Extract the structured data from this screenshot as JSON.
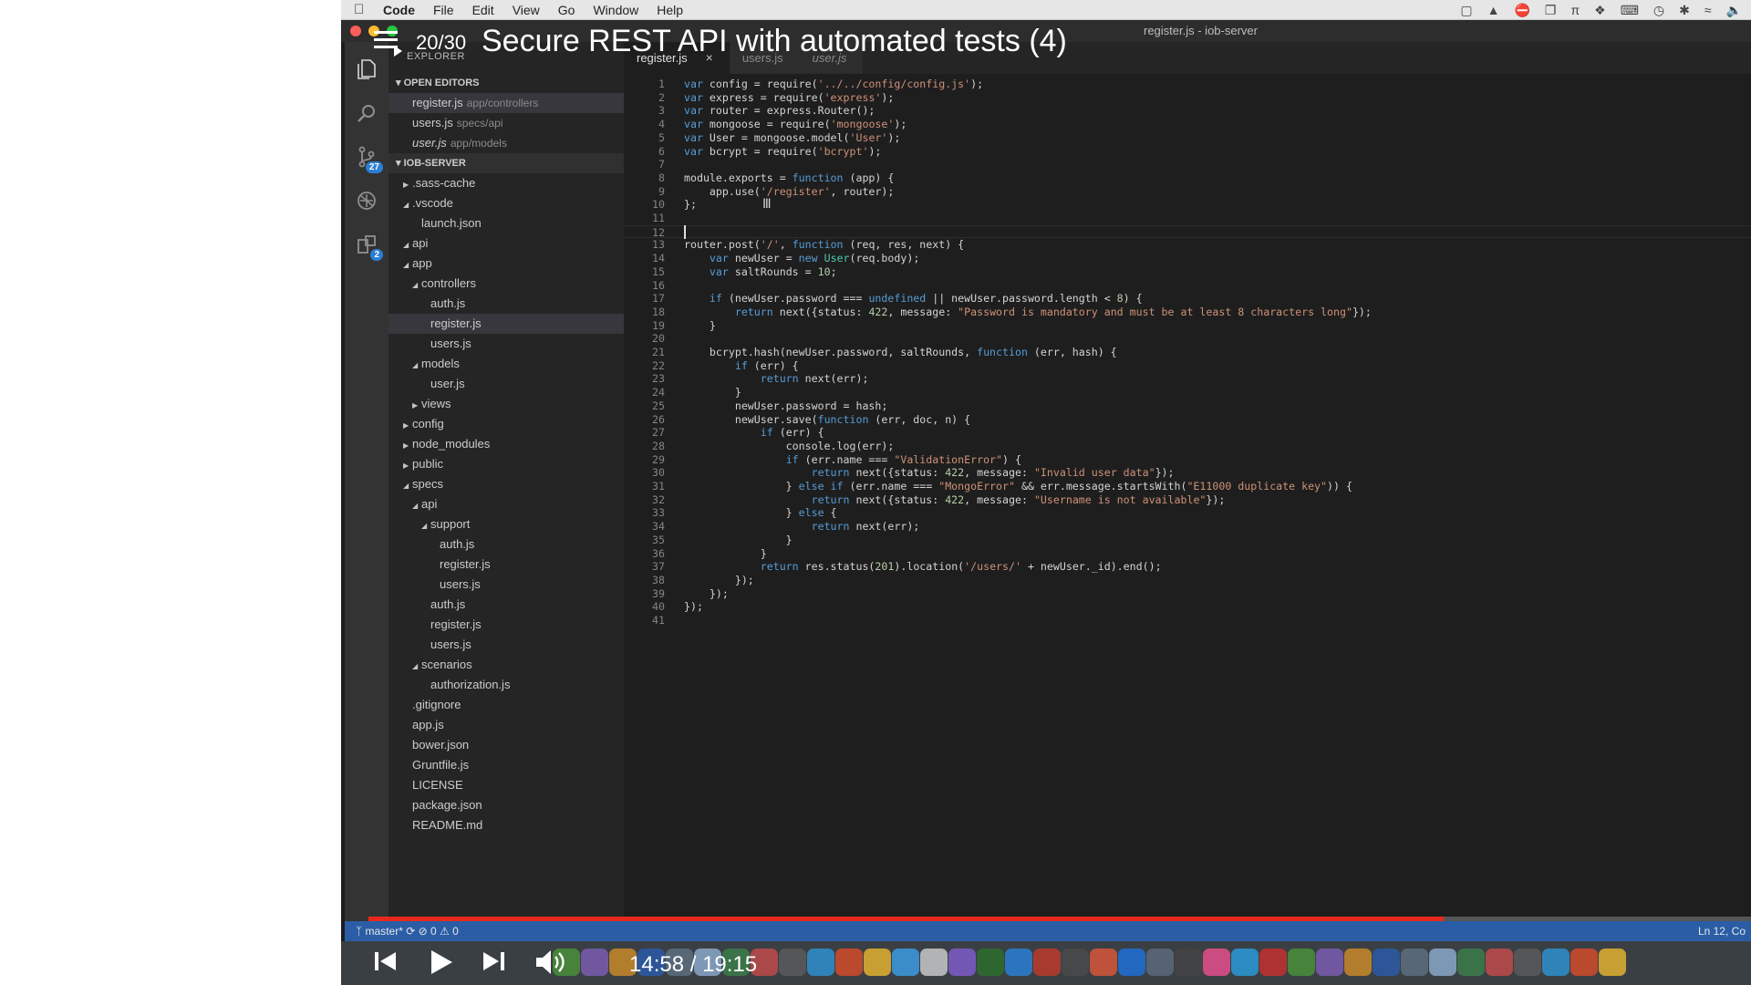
{
  "menubar": {
    "app_name": "Code",
    "items": [
      "File",
      "Edit",
      "View",
      "Go",
      "Window",
      "Help"
    ]
  },
  "window_title": "register.js - iob-server",
  "video": {
    "counter": "20/30",
    "title": "Secure REST API with automated tests (4)",
    "time": "14:58 / 19:15",
    "progress": 0.7777
  },
  "activity_bar": {
    "scm_badge": "27",
    "extensions_badge": "2"
  },
  "explorer": {
    "header": "EXPLORER",
    "open_editors_label": "OPEN EDITORS",
    "open_editors": [
      {
        "name": "register.js",
        "desc": "app/controllers"
      },
      {
        "name": "users.js",
        "desc": "specs/api"
      },
      {
        "name": "user.js",
        "desc": "app/models"
      }
    ],
    "root_label": "IOB-SERVER",
    "tree": [
      {
        "name": ".sass-cache",
        "depth": 0,
        "twisty": "closed"
      },
      {
        "name": ".vscode",
        "depth": 0,
        "twisty": "open"
      },
      {
        "name": "launch.json",
        "depth": 1,
        "twisty": ""
      },
      {
        "name": "api",
        "depth": 0,
        "twisty": "open"
      },
      {
        "name": "app",
        "depth": 0,
        "twisty": "open"
      },
      {
        "name": "controllers",
        "depth": 1,
        "twisty": "open"
      },
      {
        "name": "auth.js",
        "depth": 2,
        "twisty": ""
      },
      {
        "name": "register.js",
        "depth": 2,
        "twisty": "",
        "selected": true
      },
      {
        "name": "users.js",
        "depth": 2,
        "twisty": ""
      },
      {
        "name": "models",
        "depth": 1,
        "twisty": "open"
      },
      {
        "name": "user.js",
        "depth": 2,
        "twisty": ""
      },
      {
        "name": "views",
        "depth": 1,
        "twisty": "closed"
      },
      {
        "name": "config",
        "depth": 0,
        "twisty": "closed"
      },
      {
        "name": "node_modules",
        "depth": 0,
        "twisty": "closed"
      },
      {
        "name": "public",
        "depth": 0,
        "twisty": "closed"
      },
      {
        "name": "specs",
        "depth": 0,
        "twisty": "open"
      },
      {
        "name": "api",
        "depth": 1,
        "twisty": "open"
      },
      {
        "name": "support",
        "depth": 2,
        "twisty": "open"
      },
      {
        "name": "auth.js",
        "depth": 3,
        "twisty": ""
      },
      {
        "name": "register.js",
        "depth": 3,
        "twisty": ""
      },
      {
        "name": "users.js",
        "depth": 3,
        "twisty": ""
      },
      {
        "name": "auth.js",
        "depth": 2,
        "twisty": ""
      },
      {
        "name": "register.js",
        "depth": 2,
        "twisty": ""
      },
      {
        "name": "users.js",
        "depth": 2,
        "twisty": ""
      },
      {
        "name": "scenarios",
        "depth": 1,
        "twisty": "open"
      },
      {
        "name": "authorization.js",
        "depth": 2,
        "twisty": ""
      },
      {
        "name": ".gitignore",
        "depth": 0,
        "twisty": ""
      },
      {
        "name": "app.js",
        "depth": 0,
        "twisty": ""
      },
      {
        "name": "bower.json",
        "depth": 0,
        "twisty": ""
      },
      {
        "name": "Gruntfile.js",
        "depth": 0,
        "twisty": ""
      },
      {
        "name": "LICENSE",
        "depth": 0,
        "twisty": ""
      },
      {
        "name": "package.json",
        "depth": 0,
        "twisty": ""
      },
      {
        "name": "README.md",
        "depth": 0,
        "twisty": ""
      }
    ]
  },
  "tabs": [
    {
      "label": "register.js",
      "active": true,
      "close": "×"
    },
    {
      "label": "users.js",
      "active": false
    },
    {
      "label": "user.js",
      "active": false,
      "italic": true
    }
  ],
  "editor": {
    "current_line": 12,
    "lines": [
      "var config = require('../../config/config.js');",
      "var express = require('express');",
      "var router = express.Router();",
      "var mongoose = require('mongoose');",
      "var User = mongoose.model('User');",
      "var bcrypt = require('bcrypt');",
      "",
      "module.exports = function (app) {",
      "    app.use('/register', router);",
      "};",
      "",
      "",
      "router.post('/', function (req, res, next) {",
      "    var newUser = new User(req.body);",
      "    var saltRounds = 10;",
      "",
      "    if (newUser.password === undefined || newUser.password.length < 8) {",
      "        return next({status: 422, message: \"Password is mandatory and must be at least 8 characters long\"});",
      "    }",
      "",
      "    bcrypt.hash(newUser.password, saltRounds, function (err, hash) {",
      "        if (err) {",
      "            return next(err);",
      "        }",
      "        newUser.password = hash;",
      "        newUser.save(function (err, doc, n) {",
      "            if (err) {",
      "                console.log(err);",
      "                if (err.name === \"ValidationError\") {",
      "                    return next({status: 422, message: \"Invalid user data\"});",
      "                } else if (err.name === \"MongoError\" && err.message.startsWith(\"E11000 duplicate key\")) {",
      "                    return next({status: 422, message: \"Username is not available\"});",
      "                } else {",
      "                    return next(err);",
      "                }",
      "            }",
      "            return res.status(201).location('/users/' + newUser._id).end();",
      "        });",
      "    });",
      "});",
      ""
    ]
  },
  "statusbar": {
    "branch": "master*",
    "problems": "⊘ 0  ⚠ 0",
    "position": "Ln 12, Co"
  },
  "colors": {
    "progress": "#e8281c",
    "statusbar": "#2a5da6",
    "editor_bg": "#1e1e1e"
  }
}
